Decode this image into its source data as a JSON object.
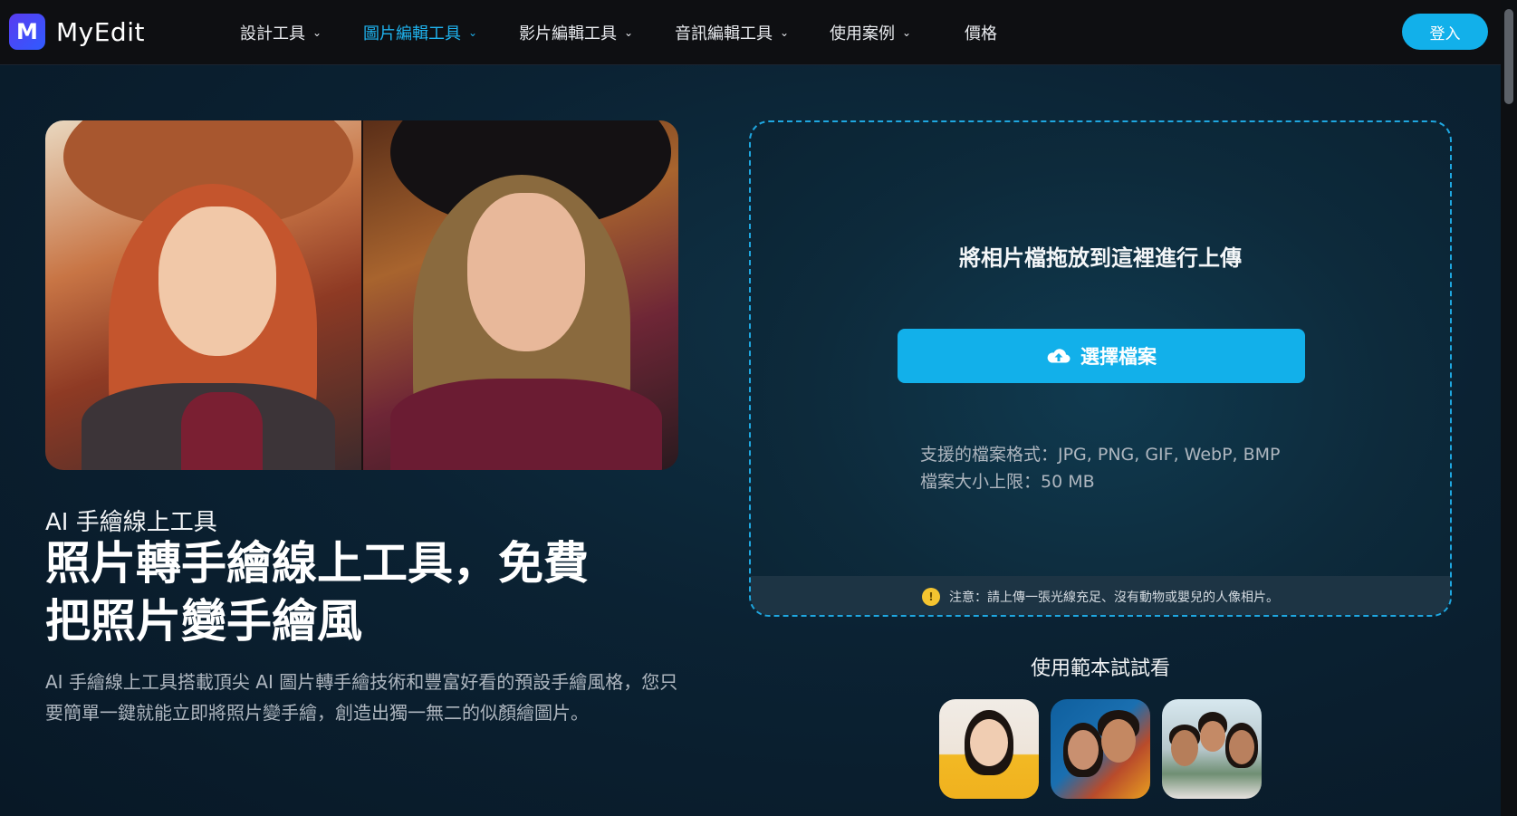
{
  "brand": {
    "name": "MyEdit",
    "logo_letter": "M"
  },
  "nav": {
    "items": [
      {
        "label": "設計工具",
        "has_dropdown": true,
        "active": false
      },
      {
        "label": "圖片編輯工具",
        "has_dropdown": true,
        "active": true
      },
      {
        "label": "影片編輯工具",
        "has_dropdown": true,
        "active": false
      },
      {
        "label": "音訊編輯工具",
        "has_dropdown": true,
        "active": false
      },
      {
        "label": "使用案例",
        "has_dropdown": true,
        "active": false
      },
      {
        "label": "價格",
        "has_dropdown": false,
        "active": false
      }
    ],
    "login_label": "登入"
  },
  "hero": {
    "eyebrow": "AI 手繪線上工具",
    "headline_line1": "照片轉手繪線上工具，免費",
    "headline_line2": "把照片變手繪風",
    "description": "AI 手繪線上工具搭載頂尖 AI 圖片轉手繪技術和豐富好看的預設手繪風格，您只要簡單一鍵就能立即將照片變手繪，創造出獨一無二的似顏繪圖片。"
  },
  "upload": {
    "drop_title": "將相片檔拖放到這裡進行上傳",
    "choose_label": "選擇檔案",
    "formats_line": "支援的檔案格式：JPG, PNG, GIF, WebP, BMP",
    "size_line": "檔案大小上限：50 MB",
    "notice": "注意：請上傳一張光線充足、沒有動物或嬰兒的人像相片。"
  },
  "samples": {
    "title": "使用範本試試看"
  },
  "colors": {
    "accent": "#12b0ea",
    "nav_bg": "#0e0f12",
    "page_bg": "#0b2233"
  },
  "icons": [
    "chevron-down-icon",
    "cloud-upload-icon",
    "lightbulb-icon"
  ]
}
